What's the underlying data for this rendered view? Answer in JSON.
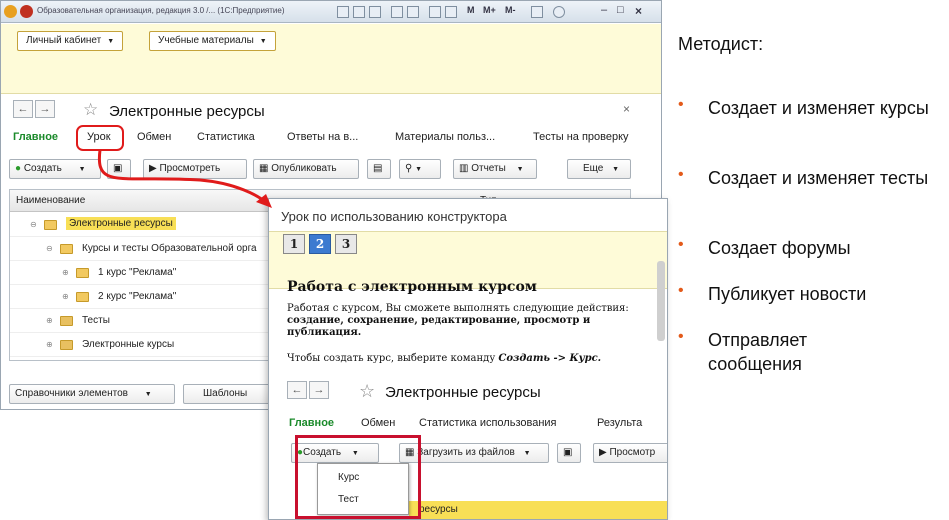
{
  "main_window": {
    "title": "Образовательная организация, редакция 3.0 /... (1С:Предприятие)",
    "title_buttons": [
      "M",
      "M+",
      "M-"
    ],
    "top_buttons": [
      "Личный кабинет",
      "Учебные материалы"
    ],
    "page_title": "Электронные ресурсы",
    "tabs": [
      "Главное",
      "Урок",
      "Обмен",
      "Статистика",
      "Ответы на в...",
      "Материалы польз...",
      "Тесты на проверку"
    ],
    "toolbar": {
      "create": "Создать",
      "view": "Просмотреть",
      "publish": "Опубликовать",
      "reports": "Отчеты",
      "more": "Еще"
    },
    "grid": {
      "header_name": "Наименование",
      "header_type": "Тип",
      "rows": [
        {
          "label": "Электронные ресурсы",
          "level": 0,
          "selected": true
        },
        {
          "label": "Курсы и тесты Образовательной орга",
          "level": 1,
          "selected": false
        },
        {
          "label": "1 курс \"Реклама\"",
          "level": 2,
          "selected": false
        },
        {
          "label": "2 курс \"Реклама\"",
          "level": 2,
          "selected": false
        },
        {
          "label": "Тесты",
          "level": 1,
          "selected": false
        },
        {
          "label": "Электронные курсы",
          "level": 1,
          "selected": false
        }
      ]
    },
    "bottom": {
      "references": "Справочники элементов",
      "templates": "Шаблоны"
    }
  },
  "lesson_window": {
    "title": "Урок по использованию конструктора",
    "pages": [
      "1",
      "2",
      "3"
    ],
    "active_page": "2",
    "heading": "Работа с электронным курсом",
    "para1": "Работая с курсом, Вы сможете выполнять следующие действия:",
    "para1_bold": "создание, сохранение, редактирование, просмотр и публикация.",
    "para2_prefix": "Чтобы создать курс, выберите команду ",
    "para2_cmd": "Создать -> Курс.",
    "inner": {
      "page_title": "Электронные ресурсы",
      "tabs": [
        "Главное",
        "Обмен",
        "Статистика использования",
        "Результа"
      ],
      "create": "Создать",
      "load": "Загрузить из файлов",
      "view": "Просмотр",
      "dropdown": [
        "Курс",
        "Тест"
      ],
      "row_label": "ресурсы"
    }
  },
  "right_panel": {
    "heading": "Методист:",
    "bullets": [
      "Создает и изменяет курсы",
      "Создает и изменяет тесты",
      "Создает форумы",
      "Публикует новости",
      "Отправляет сообщения"
    ]
  },
  "colors": {
    "accent_red": "#e01b1b",
    "tab_green": "#1a8a2a",
    "yellow": "#fefbd8",
    "bullet_orange": "#e35a1a"
  }
}
